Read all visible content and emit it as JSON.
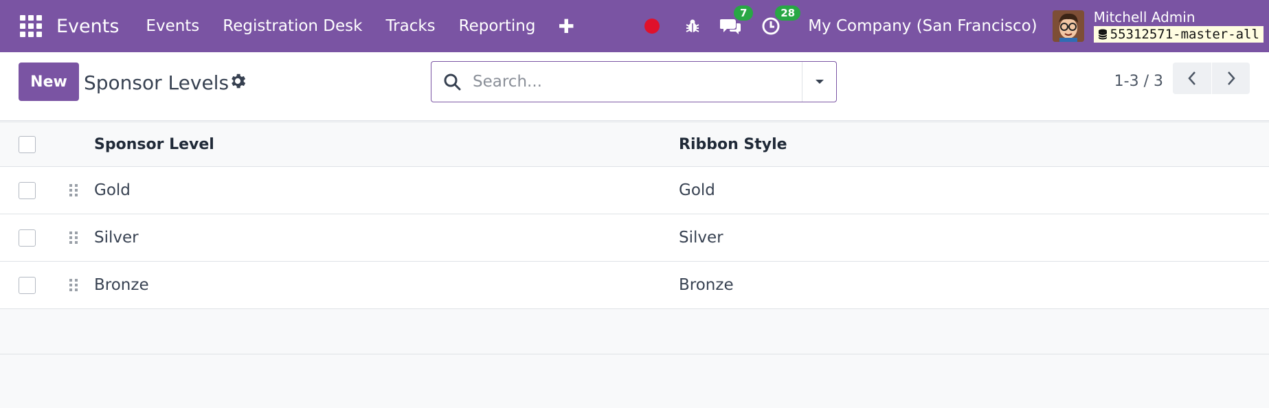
{
  "navbar": {
    "brand": "Events",
    "menu": [
      "Events",
      "Registration Desk",
      "Tracks",
      "Reporting"
    ],
    "plus_label": "✚",
    "messages_count": "7",
    "activities_count": "28",
    "company": "My Company (San Francisco)",
    "user_name": "Mitchell Admin",
    "db_name": "55312571-master-all"
  },
  "control": {
    "new_label": "New",
    "title": "Sponsor Levels",
    "search_placeholder": "Search...",
    "pager": "1-3 / 3"
  },
  "table": {
    "columns": [
      "Sponsor Level",
      "Ribbon Style"
    ],
    "rows": [
      {
        "level": "Gold",
        "ribbon": "Gold"
      },
      {
        "level": "Silver",
        "ribbon": "Silver"
      },
      {
        "level": "Bronze",
        "ribbon": "Bronze"
      }
    ]
  },
  "colors": {
    "brand": "#7a54a3",
    "record": "#e0112b",
    "badge": "#28a745"
  }
}
